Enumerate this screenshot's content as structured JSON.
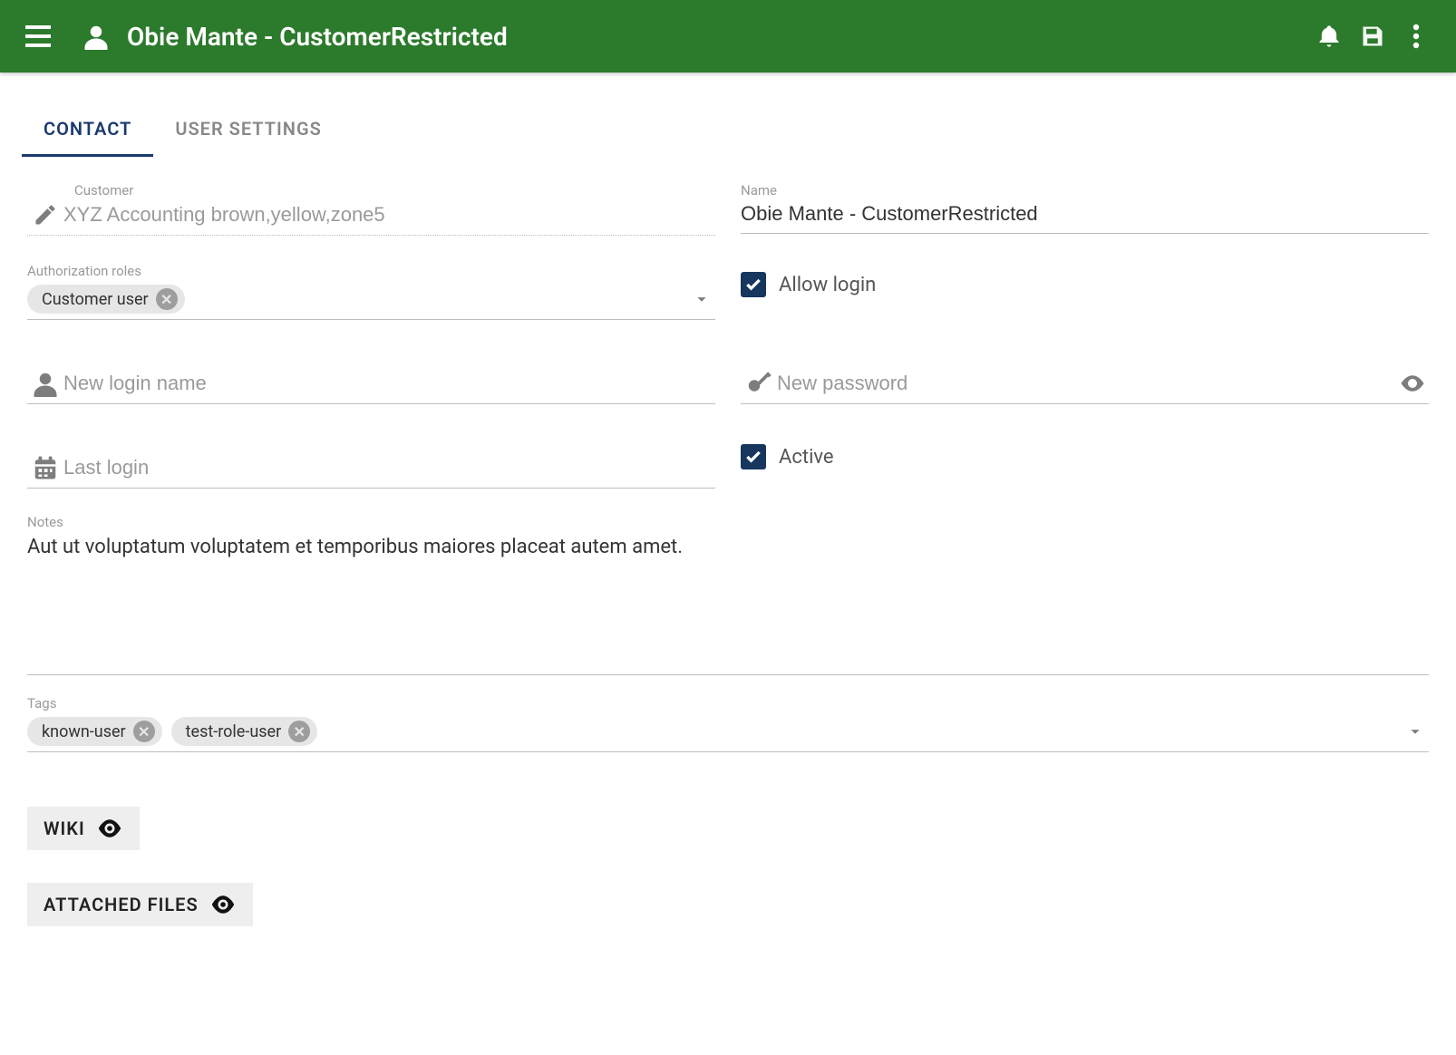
{
  "header": {
    "title": "Obie Mante - CustomerRestricted"
  },
  "tabs": {
    "contact": "CONTACT",
    "userSettings": "USER SETTINGS"
  },
  "fields": {
    "customer": {
      "label": "Customer",
      "value": "XYZ Accounting brown,yellow,zone5"
    },
    "name": {
      "label": "Name",
      "value": "Obie Mante - CustomerRestricted"
    },
    "authRoles": {
      "label": "Authorization roles",
      "chips": [
        "Customer user"
      ]
    },
    "allowLogin": {
      "label": "Allow login",
      "checked": true
    },
    "loginName": {
      "placeholder": "New login name",
      "value": ""
    },
    "password": {
      "placeholder": "New password",
      "value": ""
    },
    "lastLogin": {
      "placeholder": "Last login",
      "value": ""
    },
    "active": {
      "label": "Active",
      "checked": true
    },
    "notes": {
      "label": "Notes",
      "value": "Aut ut voluptatum voluptatem et temporibus maiores placeat autem amet."
    },
    "tags": {
      "label": "Tags",
      "chips": [
        "known-user",
        "test-role-user"
      ]
    }
  },
  "sections": {
    "wiki": "WIKI",
    "attachedFiles": "ATTACHED FILES"
  }
}
